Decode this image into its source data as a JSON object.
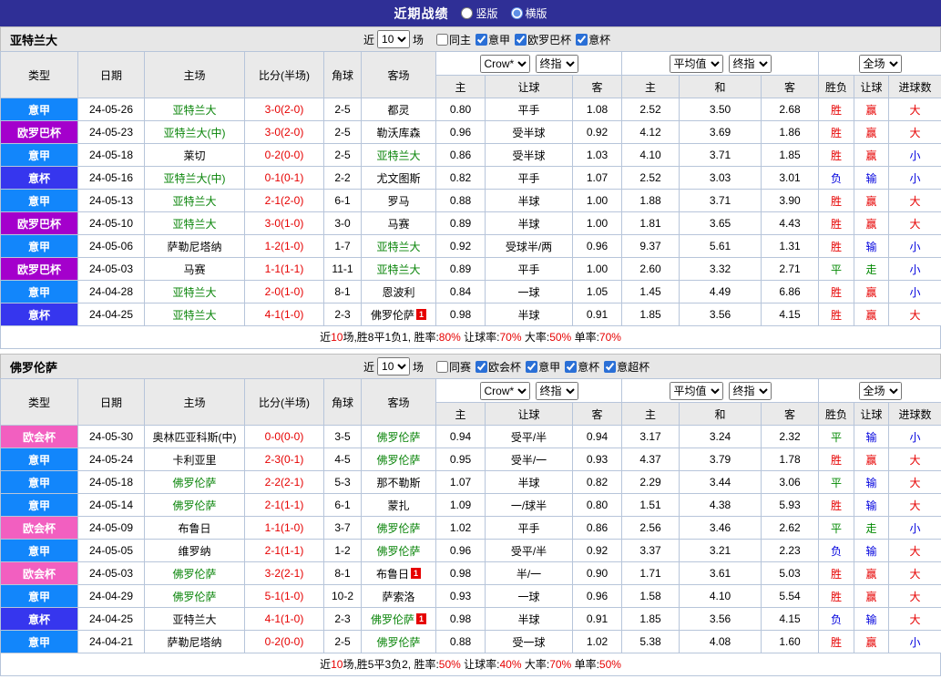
{
  "topbar": {
    "title": "近期战绩",
    "radios": [
      {
        "label": "竖版",
        "checked": false
      },
      {
        "label": "横版",
        "checked": true
      }
    ]
  },
  "columns": {
    "type": "类型",
    "date": "日期",
    "home": "主场",
    "score": "比分(半场)",
    "corner": "角球",
    "away": "客场",
    "odd_home": "主",
    "odd_let": "让球",
    "odd_away": "客",
    "eu_home": "主",
    "eu_draw": "和",
    "eu_away": "客",
    "result": "胜负",
    "let_result": "让球",
    "goal": "进球数"
  },
  "odds_filters": {
    "book": "Crow*",
    "fin1": "终指",
    "avg": "平均值",
    "fin2": "终指",
    "scope": "全场"
  },
  "league_colors": {
    "意甲": "#1286fb",
    "欧罗巴杯": "#a400cc",
    "意杯": "#3636ee",
    "欧会杯": "#f25fc0"
  },
  "result_colors": {
    "胜": "#e60000",
    "赢": "#e60000",
    "大": "#e60000",
    "负": "#0000dd",
    "输": "#0000dd",
    "小": "#0000dd",
    "平": "#008800",
    "走": "#008800"
  },
  "sections": [
    {
      "team": "亚特兰大",
      "near": {
        "prefix": "近",
        "value": "10",
        "suffix": "场"
      },
      "filter_checks": [
        {
          "label": "同主",
          "checked": false
        },
        {
          "label": "意甲",
          "checked": true
        },
        {
          "label": "欧罗巴杯",
          "checked": true
        },
        {
          "label": "意杯",
          "checked": true
        }
      ],
      "rows": [
        {
          "league": "意甲",
          "date": "24-05-26",
          "home": "亚特兰大",
          "home_green": true,
          "score": "3-0(2-0)",
          "corner": "2-5",
          "away": "都灵",
          "o_home": "0.80",
          "o_let": "平手",
          "o_away": "1.08",
          "e_home": "2.52",
          "e_draw": "3.50",
          "e_away": "2.68",
          "result": "胜",
          "let_result": "赢",
          "goal": "大"
        },
        {
          "league": "欧罗巴杯",
          "date": "24-05-23",
          "home": "亚特兰大(中)",
          "home_green": true,
          "score": "3-0(2-0)",
          "corner": "2-5",
          "away": "勒沃库森",
          "o_home": "0.96",
          "o_let": "受半球",
          "o_away": "0.92",
          "e_home": "4.12",
          "e_draw": "3.69",
          "e_away": "1.86",
          "result": "胜",
          "let_result": "赢",
          "goal": "大"
        },
        {
          "league": "意甲",
          "date": "24-05-18",
          "home": "莱切",
          "score": "0-2(0-0)",
          "corner": "2-5",
          "away": "亚特兰大",
          "away_green": true,
          "o_home": "0.86",
          "o_let": "受半球",
          "o_away": "1.03",
          "e_home": "4.10",
          "e_draw": "3.71",
          "e_away": "1.85",
          "result": "胜",
          "let_result": "赢",
          "goal": "小"
        },
        {
          "league": "意杯",
          "date": "24-05-16",
          "home": "亚特兰大(中)",
          "home_green": true,
          "score": "0-1(0-1)",
          "corner": "2-2",
          "away": "尤文图斯",
          "o_home": "0.82",
          "o_let": "平手",
          "o_away": "1.07",
          "e_home": "2.52",
          "e_draw": "3.03",
          "e_away": "3.01",
          "result": "负",
          "let_result": "输",
          "goal": "小"
        },
        {
          "league": "意甲",
          "date": "24-05-13",
          "home": "亚特兰大",
          "home_green": true,
          "score": "2-1(2-0)",
          "corner": "6-1",
          "away": "罗马",
          "o_home": "0.88",
          "o_let": "半球",
          "o_away": "1.00",
          "e_home": "1.88",
          "e_draw": "3.71",
          "e_away": "3.90",
          "result": "胜",
          "let_result": "赢",
          "goal": "大"
        },
        {
          "league": "欧罗巴杯",
          "date": "24-05-10",
          "home": "亚特兰大",
          "home_green": true,
          "score": "3-0(1-0)",
          "corner": "3-0",
          "away": "马赛",
          "o_home": "0.89",
          "o_let": "半球",
          "o_away": "1.00",
          "e_home": "1.81",
          "e_draw": "3.65",
          "e_away": "4.43",
          "result": "胜",
          "let_result": "赢",
          "goal": "大"
        },
        {
          "league": "意甲",
          "date": "24-05-06",
          "home": "萨勒尼塔纳",
          "score": "1-2(1-0)",
          "corner": "1-7",
          "away": "亚特兰大",
          "away_green": true,
          "o_home": "0.92",
          "o_let": "受球半/两",
          "o_away": "0.96",
          "e_home": "9.37",
          "e_draw": "5.61",
          "e_away": "1.31",
          "result": "胜",
          "let_result": "输",
          "goal": "小"
        },
        {
          "league": "欧罗巴杯",
          "date": "24-05-03",
          "home": "马赛",
          "score": "1-1(1-1)",
          "corner": "11-1",
          "away": "亚特兰大",
          "away_green": true,
          "o_home": "0.89",
          "o_let": "平手",
          "o_away": "1.00",
          "e_home": "2.60",
          "e_draw": "3.32",
          "e_away": "2.71",
          "result": "平",
          "let_result": "走",
          "goal": "小"
        },
        {
          "league": "意甲",
          "date": "24-04-28",
          "home": "亚特兰大",
          "home_green": true,
          "score": "2-0(1-0)",
          "corner": "8-1",
          "away": "恩波利",
          "o_home": "0.84",
          "o_let": "一球",
          "o_away": "1.05",
          "e_home": "1.45",
          "e_draw": "4.49",
          "e_away": "6.86",
          "result": "胜",
          "let_result": "赢",
          "goal": "小"
        },
        {
          "league": "意杯",
          "date": "24-04-25",
          "home": "亚特兰大",
          "home_green": true,
          "score": "4-1(1-0)",
          "corner": "2-3",
          "away": "佛罗伦萨",
          "away_card": "1",
          "o_home": "0.98",
          "o_let": "半球",
          "o_away": "0.91",
          "e_home": "1.85",
          "e_draw": "3.56",
          "e_away": "4.15",
          "result": "胜",
          "let_result": "赢",
          "goal": "大"
        }
      ],
      "summary": [
        {
          "text": "近"
        },
        {
          "text": "10",
          "red": true
        },
        {
          "text": "场,胜8平1负1, 胜率:"
        },
        {
          "text": "80%",
          "red": true
        },
        {
          "text": " 让球率:"
        },
        {
          "text": "70%",
          "red": true
        },
        {
          "text": " 大率:"
        },
        {
          "text": "50%",
          "red": true
        },
        {
          "text": " 单率:"
        },
        {
          "text": "70%",
          "red": true
        }
      ]
    },
    {
      "team": "佛罗伦萨",
      "near": {
        "prefix": "近",
        "value": "10",
        "suffix": "场"
      },
      "filter_checks": [
        {
          "label": "同赛",
          "checked": false
        },
        {
          "label": "欧会杯",
          "checked": true
        },
        {
          "label": "意甲",
          "checked": true
        },
        {
          "label": "意杯",
          "checked": true
        },
        {
          "label": "意超杯",
          "checked": true
        }
      ],
      "rows": [
        {
          "league": "欧会杯",
          "date": "24-05-30",
          "home": "奥林匹亚科斯(中)",
          "score": "0-0(0-0)",
          "corner": "3-5",
          "away": "佛罗伦萨",
          "away_green": true,
          "o_home": "0.94",
          "o_let": "受平/半",
          "o_away": "0.94",
          "e_home": "3.17",
          "e_draw": "3.24",
          "e_away": "2.32",
          "result": "平",
          "let_result": "输",
          "goal": "小"
        },
        {
          "league": "意甲",
          "date": "24-05-24",
          "home": "卡利亚里",
          "score": "2-3(0-1)",
          "corner": "4-5",
          "away": "佛罗伦萨",
          "away_green": true,
          "o_home": "0.95",
          "o_let": "受半/一",
          "o_away": "0.93",
          "e_home": "4.37",
          "e_draw": "3.79",
          "e_away": "1.78",
          "result": "胜",
          "let_result": "赢",
          "goal": "大"
        },
        {
          "league": "意甲",
          "date": "24-05-18",
          "home": "佛罗伦萨",
          "home_green": true,
          "score": "2-2(2-1)",
          "corner": "5-3",
          "away": "那不勒斯",
          "o_home": "1.07",
          "o_let": "半球",
          "o_away": "0.82",
          "e_home": "2.29",
          "e_draw": "3.44",
          "e_away": "3.06",
          "result": "平",
          "let_result": "输",
          "goal": "大"
        },
        {
          "league": "意甲",
          "date": "24-05-14",
          "home": "佛罗伦萨",
          "home_green": true,
          "score": "2-1(1-1)",
          "corner": "6-1",
          "away": "蒙扎",
          "o_home": "1.09",
          "o_let": "一/球半",
          "o_away": "0.80",
          "e_home": "1.51",
          "e_draw": "4.38",
          "e_away": "5.93",
          "result": "胜",
          "let_result": "输",
          "goal": "大"
        },
        {
          "league": "欧会杯",
          "date": "24-05-09",
          "home": "布鲁日",
          "score": "1-1(1-0)",
          "corner": "3-7",
          "away": "佛罗伦萨",
          "away_green": true,
          "o_home": "1.02",
          "o_let": "平手",
          "o_away": "0.86",
          "e_home": "2.56",
          "e_draw": "3.46",
          "e_away": "2.62",
          "result": "平",
          "let_result": "走",
          "goal": "小"
        },
        {
          "league": "意甲",
          "date": "24-05-05",
          "home": "维罗纳",
          "score": "2-1(1-1)",
          "corner": "1-2",
          "away": "佛罗伦萨",
          "away_green": true,
          "o_home": "0.96",
          "o_let": "受平/半",
          "o_away": "0.92",
          "e_home": "3.37",
          "e_draw": "3.21",
          "e_away": "2.23",
          "result": "负",
          "let_result": "输",
          "goal": "大"
        },
        {
          "league": "欧会杯",
          "date": "24-05-03",
          "home": "佛罗伦萨",
          "home_green": true,
          "score": "3-2(2-1)",
          "corner": "8-1",
          "away": "布鲁日",
          "away_card": "1",
          "o_home": "0.98",
          "o_let": "半/一",
          "o_away": "0.90",
          "e_home": "1.71",
          "e_draw": "3.61",
          "e_away": "5.03",
          "result": "胜",
          "let_result": "赢",
          "goal": "大"
        },
        {
          "league": "意甲",
          "date": "24-04-29",
          "home": "佛罗伦萨",
          "home_green": true,
          "score": "5-1(1-0)",
          "corner": "10-2",
          "away": "萨索洛",
          "o_home": "0.93",
          "o_let": "一球",
          "o_away": "0.96",
          "e_home": "1.58",
          "e_draw": "4.10",
          "e_away": "5.54",
          "result": "胜",
          "let_result": "赢",
          "goal": "大"
        },
        {
          "league": "意杯",
          "date": "24-04-25",
          "home": "亚特兰大",
          "score": "4-1(1-0)",
          "corner": "2-3",
          "away": "佛罗伦萨",
          "away_green": true,
          "away_card": "1",
          "o_home": "0.98",
          "o_let": "半球",
          "o_away": "0.91",
          "e_home": "1.85",
          "e_draw": "3.56",
          "e_away": "4.15",
          "result": "负",
          "let_result": "输",
          "goal": "大"
        },
        {
          "league": "意甲",
          "date": "24-04-21",
          "home": "萨勒尼塔纳",
          "score": "0-2(0-0)",
          "corner": "2-5",
          "away": "佛罗伦萨",
          "away_green": true,
          "o_home": "0.88",
          "o_let": "受一球",
          "o_away": "1.02",
          "e_home": "5.38",
          "e_draw": "4.08",
          "e_away": "1.60",
          "result": "胜",
          "let_result": "赢",
          "goal": "小"
        }
      ],
      "summary": [
        {
          "text": "近"
        },
        {
          "text": "10",
          "red": true
        },
        {
          "text": "场,胜5平3负2, 胜率:"
        },
        {
          "text": "50%",
          "red": true
        },
        {
          "text": " 让球率:"
        },
        {
          "text": "40%",
          "red": true
        },
        {
          "text": " 大率:"
        },
        {
          "text": "70%",
          "red": true
        },
        {
          "text": " 单率:"
        },
        {
          "text": "50%",
          "red": true
        }
      ]
    }
  ]
}
